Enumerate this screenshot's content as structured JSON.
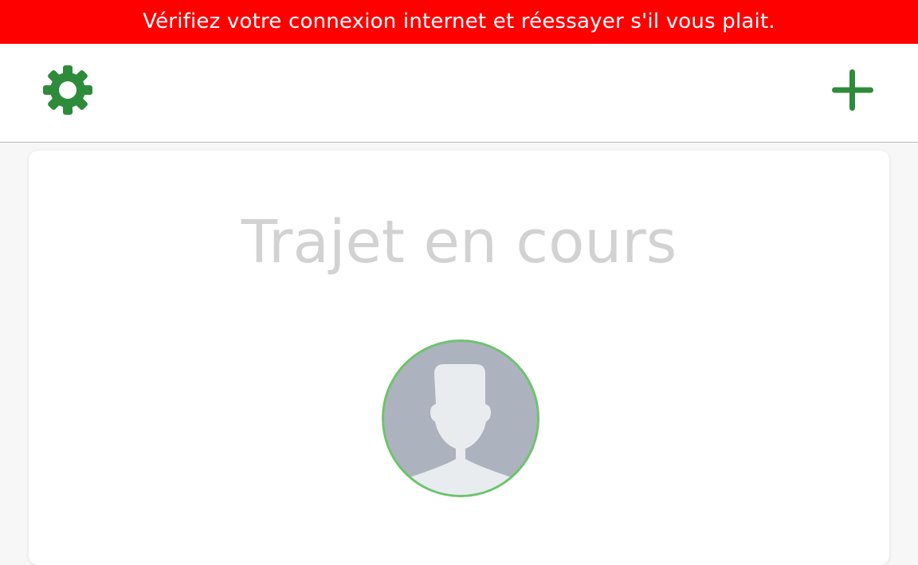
{
  "banner": {
    "message": "Vérifiez votre connexion internet et réessayer s'il vous plait.",
    "background_color": "#ff0000",
    "text_color": "#ffffff"
  },
  "toolbar": {
    "settings_icon": "gear-icon",
    "add_icon": "plus-icon",
    "icon_color": "#2e8b3a"
  },
  "card": {
    "title": "Trajet en cours",
    "avatar_icon": "user-silhouette-icon",
    "avatar_border_color": "#6cc46a",
    "avatar_background_color": "#adb2bf"
  }
}
